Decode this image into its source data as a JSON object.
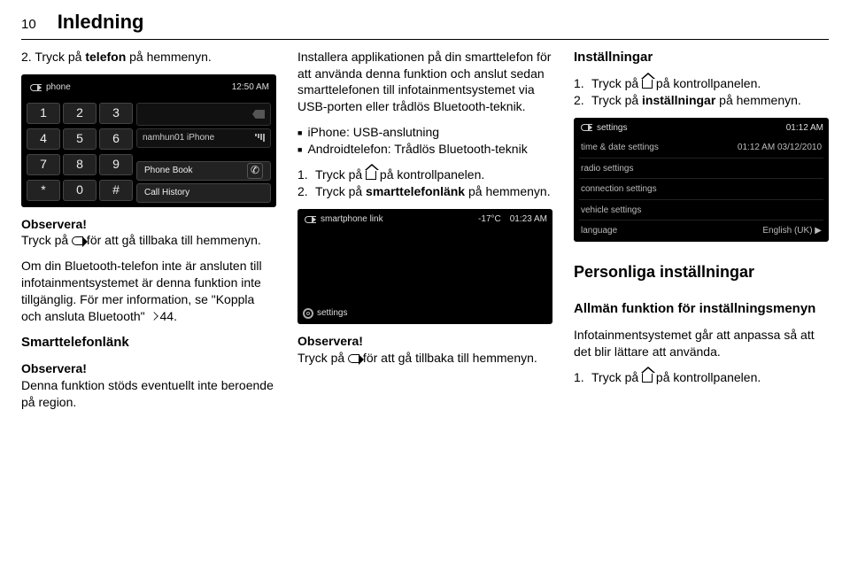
{
  "page": {
    "number": "10",
    "title": "Inledning"
  },
  "col1": {
    "step2": "2. Tryck på ",
    "step2_bold": "telefon",
    "step2_tail": " på hemmenyn.",
    "phone_shot": {
      "title": "phone",
      "time": "12:50 AM",
      "keys": [
        "1",
        "2",
        "3",
        "4",
        "5",
        "6",
        "7",
        "8",
        "9",
        "*",
        "0",
        "#"
      ],
      "device": "namhun01 iPhone",
      "book": "Phone Book",
      "history": "Call History"
    },
    "observe": "Observera!",
    "back_text1": "Tryck på ",
    "back_text2": " för att gå tillbaka till hemmenyn.",
    "bt_para": "Om din Bluetooth-telefon inte är ansluten till infotainmentsystemet är denna funktion inte tillgänglig. För mer information, se \"Koppla och ansluta Bluetooth\" ",
    "bt_ref": "44.",
    "smartlink_head": "Smarttelefonlänk",
    "observe2": "Observera!",
    "region_note": "Denna funktion stöds eventuellt inte beroende på region."
  },
  "col2": {
    "install_para": "Installera applikationen på din smarttelefon för att använda denna funktion och anslut sedan smarttelefonen till infotainmentsystemet via USB-porten eller trådlös Bluetooth-teknik.",
    "bullet_iphone": "iPhone: USB-anslutning",
    "bullet_android": "Androidtelefon: Trådlös Bluetooth-teknik",
    "step1a": "1.",
    "step1b": "Tryck på ",
    "step1c": " på kontrollpanelen.",
    "step2a": "2.",
    "step2b": "Tryck på ",
    "step2_bold": "smarttelefonlänk",
    "step2c": " på hemmenyn.",
    "smartphone_shot": {
      "title": "smartphone link",
      "temp": "-17°C",
      "time": "01:23 AM",
      "settings": "settings"
    },
    "observe": "Observera!",
    "back_text1": "Tryck på ",
    "back_text2": " för att gå tillbaka till hemmenyn."
  },
  "col3": {
    "settings_head": "Inställningar",
    "step1a": "1.",
    "step1b": "Tryck på ",
    "step1c": " på kontrollpanelen.",
    "step2a": "2.",
    "step2b": "Tryck på ",
    "step2_bold": "inställningar",
    "step2c": " på hemmenyn.",
    "settings_shot": {
      "title": "settings",
      "time_right": "01:12 AM",
      "rows": [
        {
          "l": "time & date settings",
          "r": "01:12 AM  03/12/2010"
        },
        {
          "l": "radio settings",
          "r": ""
        },
        {
          "l": "connection settings",
          "r": ""
        },
        {
          "l": "vehicle settings",
          "r": ""
        },
        {
          "l": "language",
          "r": "English (UK)  ▶"
        }
      ]
    },
    "personal_head": "Personliga inställningar",
    "sub_head": "Allmän funktion för inställningsmenyn",
    "personal_para": "Infotainmentsystemet går att anpassa så att det blir lättare att använda.",
    "p_step1a": "1.",
    "p_step1b": "Tryck på ",
    "p_step1c": " på kontrollpanelen."
  }
}
